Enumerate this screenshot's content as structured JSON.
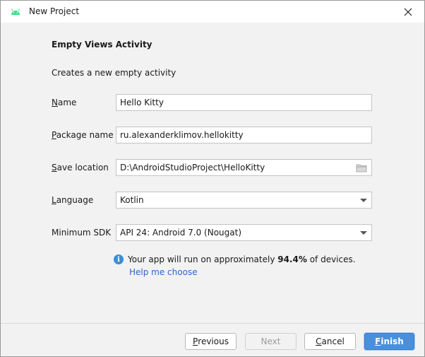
{
  "window": {
    "title": "New Project",
    "icon": "android-icon",
    "close_icon": "close-icon"
  },
  "page": {
    "heading": "Empty Views Activity",
    "description": "Creates a new empty activity"
  },
  "form": {
    "name": {
      "label_mnemonic": "N",
      "label_rest": "ame",
      "value": "Hello Kitty"
    },
    "package": {
      "label_mnemonic": "P",
      "label_rest": "ackage name",
      "value": "ru.alexanderklimov.hellokitty"
    },
    "location": {
      "label_mnemonic": "S",
      "label_rest": "ave location",
      "value": "D:\\AndroidStudioProject\\HelloKitty",
      "icon": "folder-icon"
    },
    "language": {
      "label_mnemonic": "L",
      "label_rest": "anguage",
      "value": "Kotlin"
    },
    "min_sdk": {
      "label": "Minimum SDK",
      "value": "API 24: Android 7.0 (Nougat)"
    }
  },
  "info": {
    "icon": "info-icon",
    "text_before": "Your app will run on approximately ",
    "percent": "94.4%",
    "text_after": " of devices.",
    "help_link": "Help me choose"
  },
  "buttons": {
    "previous_mnemonic": "P",
    "previous_rest": "revious",
    "next": "Next",
    "cancel_mnemonic": "C",
    "cancel_rest": "ancel",
    "finish_mnemonic": "F",
    "finish_rest": "inish"
  },
  "colors": {
    "accent": "#4a8fdc",
    "link": "#2f65ca",
    "android_green": "#3ddc84",
    "info_blue": "#3a8fd6"
  }
}
